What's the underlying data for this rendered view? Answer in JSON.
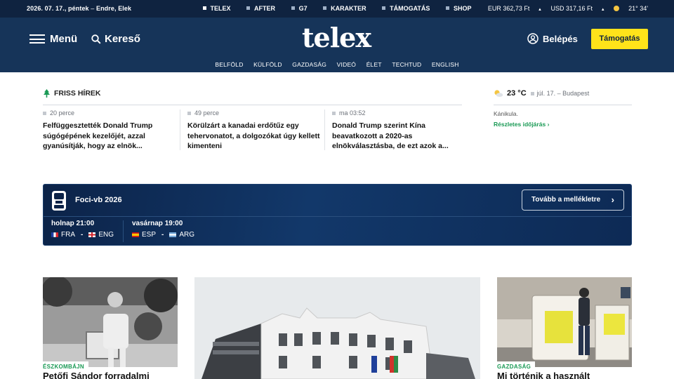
{
  "topbar": {
    "date": "2026. 07. 17., péntek",
    "namedays": "Endre, Elek",
    "links": [
      "TELEX",
      "AFTER",
      "G7",
      "KARAKTER",
      "TÁMOGATÁS",
      "SHOP"
    ],
    "eur": "EUR 362,73 Ft",
    "usd": "USD 317,16 Ft",
    "temp": "21° 34'"
  },
  "header": {
    "menu_label": "Menü",
    "search_label": "Kereső",
    "logo": "telex",
    "login_label": "Belépés",
    "support_label": "Támogatás",
    "nav": [
      "BELFÖLD",
      "KÜLFÖLD",
      "GAZDASÁG",
      "VIDEÓ",
      "ÉLET",
      "TECHTUD",
      "ENGLISH"
    ]
  },
  "friss": {
    "heading": "FRISS HÍREK",
    "items": [
      {
        "time": "20 perce",
        "title": "Felfüggesztették Donald Trump súgógépének kezelőjét, azzal gyanúsítják, hogy az elnök..."
      },
      {
        "time": "49 perce",
        "title": "Körülzárt a kanadai erdőtűz egy tehervonatot, a dolgozókat úgy kellett kimenteni"
      },
      {
        "time": "ma 03:52",
        "title": "Donald Trump szerint Kína beavatkozott a 2020-as elnökválasztásba, de ezt azok a..."
      }
    ]
  },
  "weather": {
    "temp": "23 °C",
    "date_place": "júl. 17. – Budapest",
    "desc": "Kánikula.",
    "more": "Részletes időjárás"
  },
  "foci": {
    "title": "Foci-vb 2026",
    "cta": "Tovább a mellékletre",
    "matches": [
      {
        "when": "holnap 21:00",
        "home": "FRA",
        "away": "ENG"
      },
      {
        "when": "vasárnap 19:00",
        "home": "ESP",
        "away": "ARG"
      }
    ]
  },
  "articles": [
    {
      "tag": "ÉSZKOMBÁJN",
      "title": "Petőfi Sándor forradalmi"
    },
    {
      "tag": "",
      "title": ""
    },
    {
      "tag": "GAZDASÁG",
      "title": "Mi történik a használt"
    }
  ],
  "colors": {
    "navy": "#163459",
    "accent_yellow": "#ffe31a",
    "tag_green": "#1a9a55"
  }
}
